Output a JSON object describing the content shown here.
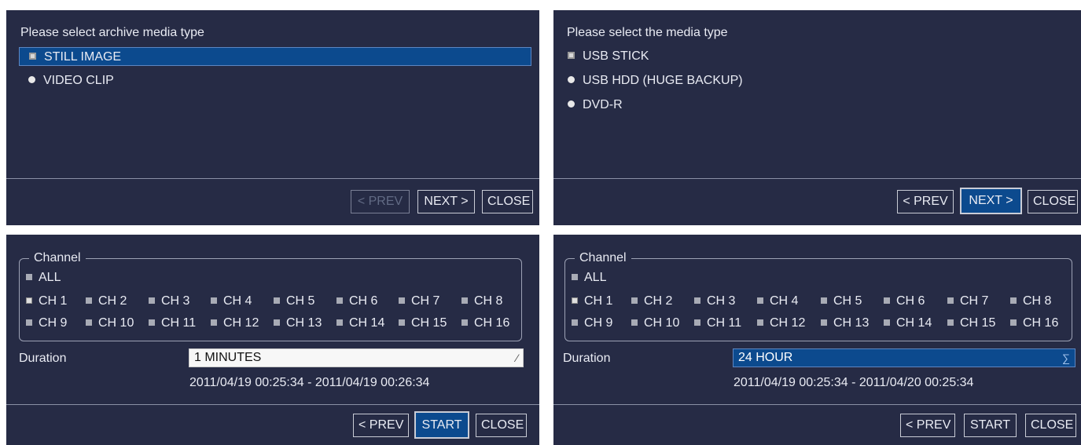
{
  "panels": [
    {
      "title": "Please select archive media type",
      "options": [
        "STILL IMAGE",
        "VIDEO CLIP"
      ],
      "selected_index": 0,
      "buttons": {
        "prev": "< PREV",
        "next": "NEXT >",
        "close": "CLOSE"
      }
    },
    {
      "title": "Please select the media type",
      "options": [
        "USB STICK",
        "USB HDD (HUGE BACKUP)",
        "DVD-R"
      ],
      "selected_index": 0,
      "buttons": {
        "prev": "< PREV",
        "next": "NEXT >",
        "close": "CLOSE"
      }
    },
    {
      "channel_group_label": "Channel",
      "all_label": "ALL",
      "channels_row1": [
        "CH 1",
        "CH 2",
        "CH 3",
        "CH 4",
        "CH 5",
        "CH 6",
        "CH 7",
        "CH 8"
      ],
      "channels_row2": [
        "CH 9",
        "CH 10",
        "CH 11",
        "CH 12",
        "CH 13",
        "CH 14",
        "CH 15",
        "CH 16"
      ],
      "checked_channel": "CH 1",
      "duration_label": "Duration",
      "duration_value": "1 MINUTES",
      "time_range": "2011/04/19 00:25:34 - 2011/04/19 00:26:34",
      "buttons": {
        "prev": "< PREV",
        "start": "START",
        "close": "CLOSE"
      }
    },
    {
      "channel_group_label": "Channel",
      "all_label": "ALL",
      "channels_row1": [
        "CH 1",
        "CH 2",
        "CH 3",
        "CH 4",
        "CH 5",
        "CH 6",
        "CH 7",
        "CH 8"
      ],
      "channels_row2": [
        "CH 9",
        "CH 10",
        "CH 11",
        "CH 12",
        "CH 13",
        "CH 14",
        "CH 15",
        "CH 16"
      ],
      "checked_channel": "CH 1",
      "duration_label": "Duration",
      "duration_value": "24 HOUR",
      "time_range": "2011/04/19 00:25:34 - 2011/04/20 00:25:34",
      "buttons": {
        "prev": "< PREV",
        "start": "START",
        "close": "CLOSE"
      }
    }
  ],
  "colors": {
    "panel_bg": "#262b45",
    "selection": "#0c4a8e",
    "text": "#e9ebf3",
    "disabled_text": "#626b85"
  },
  "icons": {
    "selected_marker": "checkbox-marker-icon",
    "unselected_marker": "bullet-icon",
    "dropdown": "dropdown-arrow-icon"
  }
}
